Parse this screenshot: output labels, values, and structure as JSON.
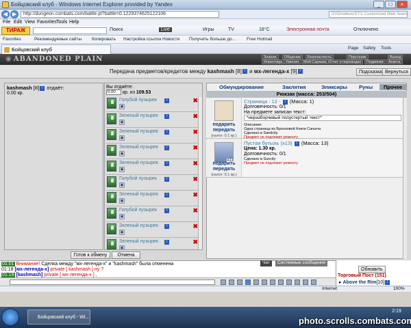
{
  "window": {
    "title": "Бойцовский клуб - Windows Internet Explorer provided by Yandex"
  },
  "browser": {
    "url": "http://dungeon.combats.com/battle.pl?battle=0.1229374625122106",
    "search_placeholder": "DVD/videos/ST/1 Customized Web Search",
    "menu": [
      "File",
      "Edit",
      "View",
      "Favorites",
      "Tools",
      "Help"
    ],
    "toolbar": {
      "logo": "ТИРАЖ",
      "search": "Поиск",
      "live": "Live",
      "games": "Игры",
      "tv": "TV",
      "temp": "18°C",
      "mail": "Электронная почта",
      "off": "Отключено"
    },
    "favorites": [
      "Favorites",
      "Рекомендуемые сайты",
      "Копировать",
      "Настройка ссылок",
      "Новости",
      "Получить больше до...",
      "Free Hotmail"
    ],
    "tab_title": "Бойцовский клуб",
    "tab_right": [
      "Page",
      "Safety",
      "Tools"
    ],
    "status": {
      "zone": "Internet",
      "zoom": "100%"
    }
  },
  "game": {
    "brand": "ABANDONED PLAIN",
    "menu": [
      "Знания",
      "Общение",
      "Безопасность",
      "Персонаж",
      "Выход",
      "Инвентарь",
      "Умения",
      "Мой Сарказм",
      "Отчет о переводах",
      "Подвинки",
      "Анкета"
    ],
    "transfer": {
      "text_prefix": "Передача предметов/кредитов между",
      "user1": "kashmash",
      "user1_level": "[8]",
      "and": "и",
      "user2": "мх-легенда-х",
      "user2_level": "[9]",
      "hint_button": "Подсказка",
      "return_button": "Вернуться"
    },
    "left": {
      "header_user": "kashmash",
      "header_level": "[8]",
      "header_suffix": "отдаёт:",
      "amount": "0.00 кр."
    },
    "mid": {
      "header": "Вы отдаёте:",
      "amount_value": "0.00",
      "amount_suffix": "кр. из",
      "total": "109.53",
      "items": [
        "Голубой пузырек",
        "Зеленый пузырек",
        "Зеленый пузырек",
        "Зеленый пузырек",
        "Зеленый пузырек",
        "Голубой пузырек",
        "Зеленый пузырек",
        "Голубой пузырек",
        "Зеленый пузырек",
        "Зеленый пузырек"
      ],
      "ready_button": "Готов к обмену",
      "cancel_button": "Отмена"
    },
    "right": {
      "tabs": [
        "Обмундирование",
        "Заклятия",
        "Эликсиры",
        "Руны",
        "Прочее"
      ],
      "backpack": "Рюкзак (масса: 253/504)",
      "items": [
        {
          "name": "Страница - 12 -",
          "mass": "(Масса: 1)",
          "durability": "Долговечность: 0/1",
          "written_label": "На предмете записан текст:",
          "written": "*неразборчивый полустертый текст*",
          "desc_label": "Описание:",
          "desc": "Одна страница из Бронзовой Книги Саныча",
          "made": "Сделано в Sandcity",
          "warn": "Предмет не подлежит ремонту",
          "give": "подарить передать",
          "tax": "(налог: 0.1 кр.)"
        },
        {
          "name": "Пустая бутыль (x13)",
          "mass": "(Масса: 13)",
          "price": "Цена: 1.30 кр.",
          "durability": "Долговечность: 0/1",
          "made": "Сделано в Suncity",
          "warn": "Предмет не подлежит ремонту",
          "give": "подарить передать",
          "tax": "(налог: 0.1 кр.)",
          "count": "x13"
        }
      ]
    },
    "chat": {
      "lines": [
        {
          "time": "01:01",
          "prefix": "Внимание!",
          "text": " Сделка между \"мх-легенда-х\" и \"kashmash\" была отменена"
        },
        {
          "time": "01:18",
          "prefix": "[мх-легенда-х]",
          "text": " private [ kashmash ] ну ?"
        },
        {
          "time": "01:19",
          "prefix": "[kashmash]",
          "text": " private [ мх-легенда-х ] ,"
        }
      ],
      "tabs": [
        "Чат",
        "Системные сообщения"
      ]
    },
    "online": {
      "refresh": "Обновить",
      "title": "Торговый Пост (151)",
      "user": "Above the Rim",
      "user_level": "[10]"
    }
  },
  "taskbar": {
    "task": "Бойцовский клуб - Wi...",
    "time": "2:19"
  },
  "watermark": "photo.scrolls.combats.com"
}
